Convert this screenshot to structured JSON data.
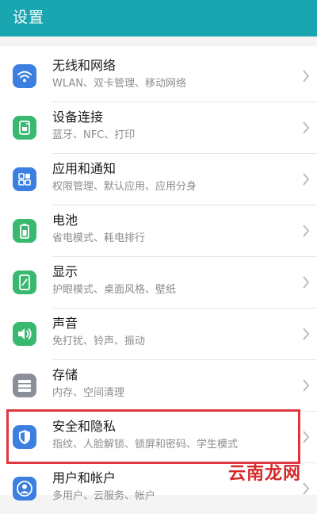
{
  "header": {
    "title": "设置"
  },
  "items": [
    {
      "title": "无线和网络",
      "subtitle": "WLAN、双卡管理、移动网络",
      "icon": "wifi-icon",
      "color": "#3b7fe1"
    },
    {
      "title": "设备连接",
      "subtitle": "蓝牙、NFC、打印",
      "icon": "device-connect-icon",
      "color": "#39b870"
    },
    {
      "title": "应用和通知",
      "subtitle": "权限管理、默认应用、应用分身",
      "icon": "apps-icon",
      "color": "#3b7fe1"
    },
    {
      "title": "电池",
      "subtitle": "省电模式、耗电排行",
      "icon": "battery-icon",
      "color": "#39b870"
    },
    {
      "title": "显示",
      "subtitle": "护眼模式、桌面风格、壁纸",
      "icon": "display-icon",
      "color": "#39b870"
    },
    {
      "title": "声音",
      "subtitle": "免打扰、铃声、振动",
      "icon": "sound-icon",
      "color": "#39b870"
    },
    {
      "title": "存储",
      "subtitle": "内存、空间清理",
      "icon": "storage-icon",
      "color": "#8a8f99"
    },
    {
      "title": "安全和隐私",
      "subtitle": "指纹、人脸解锁、锁屏和密码、学生模式",
      "icon": "shield-icon",
      "color": "#3b7fe1"
    },
    {
      "title": "用户和帐户",
      "subtitle": "多用户、云服务、帐户",
      "icon": "user-account-icon",
      "color": "#3b7fe1"
    }
  ],
  "watermark": {
    "text": "云南龙网"
  },
  "colors": {
    "header_bg": "#1aa6b0",
    "highlight": "#e0353f"
  }
}
